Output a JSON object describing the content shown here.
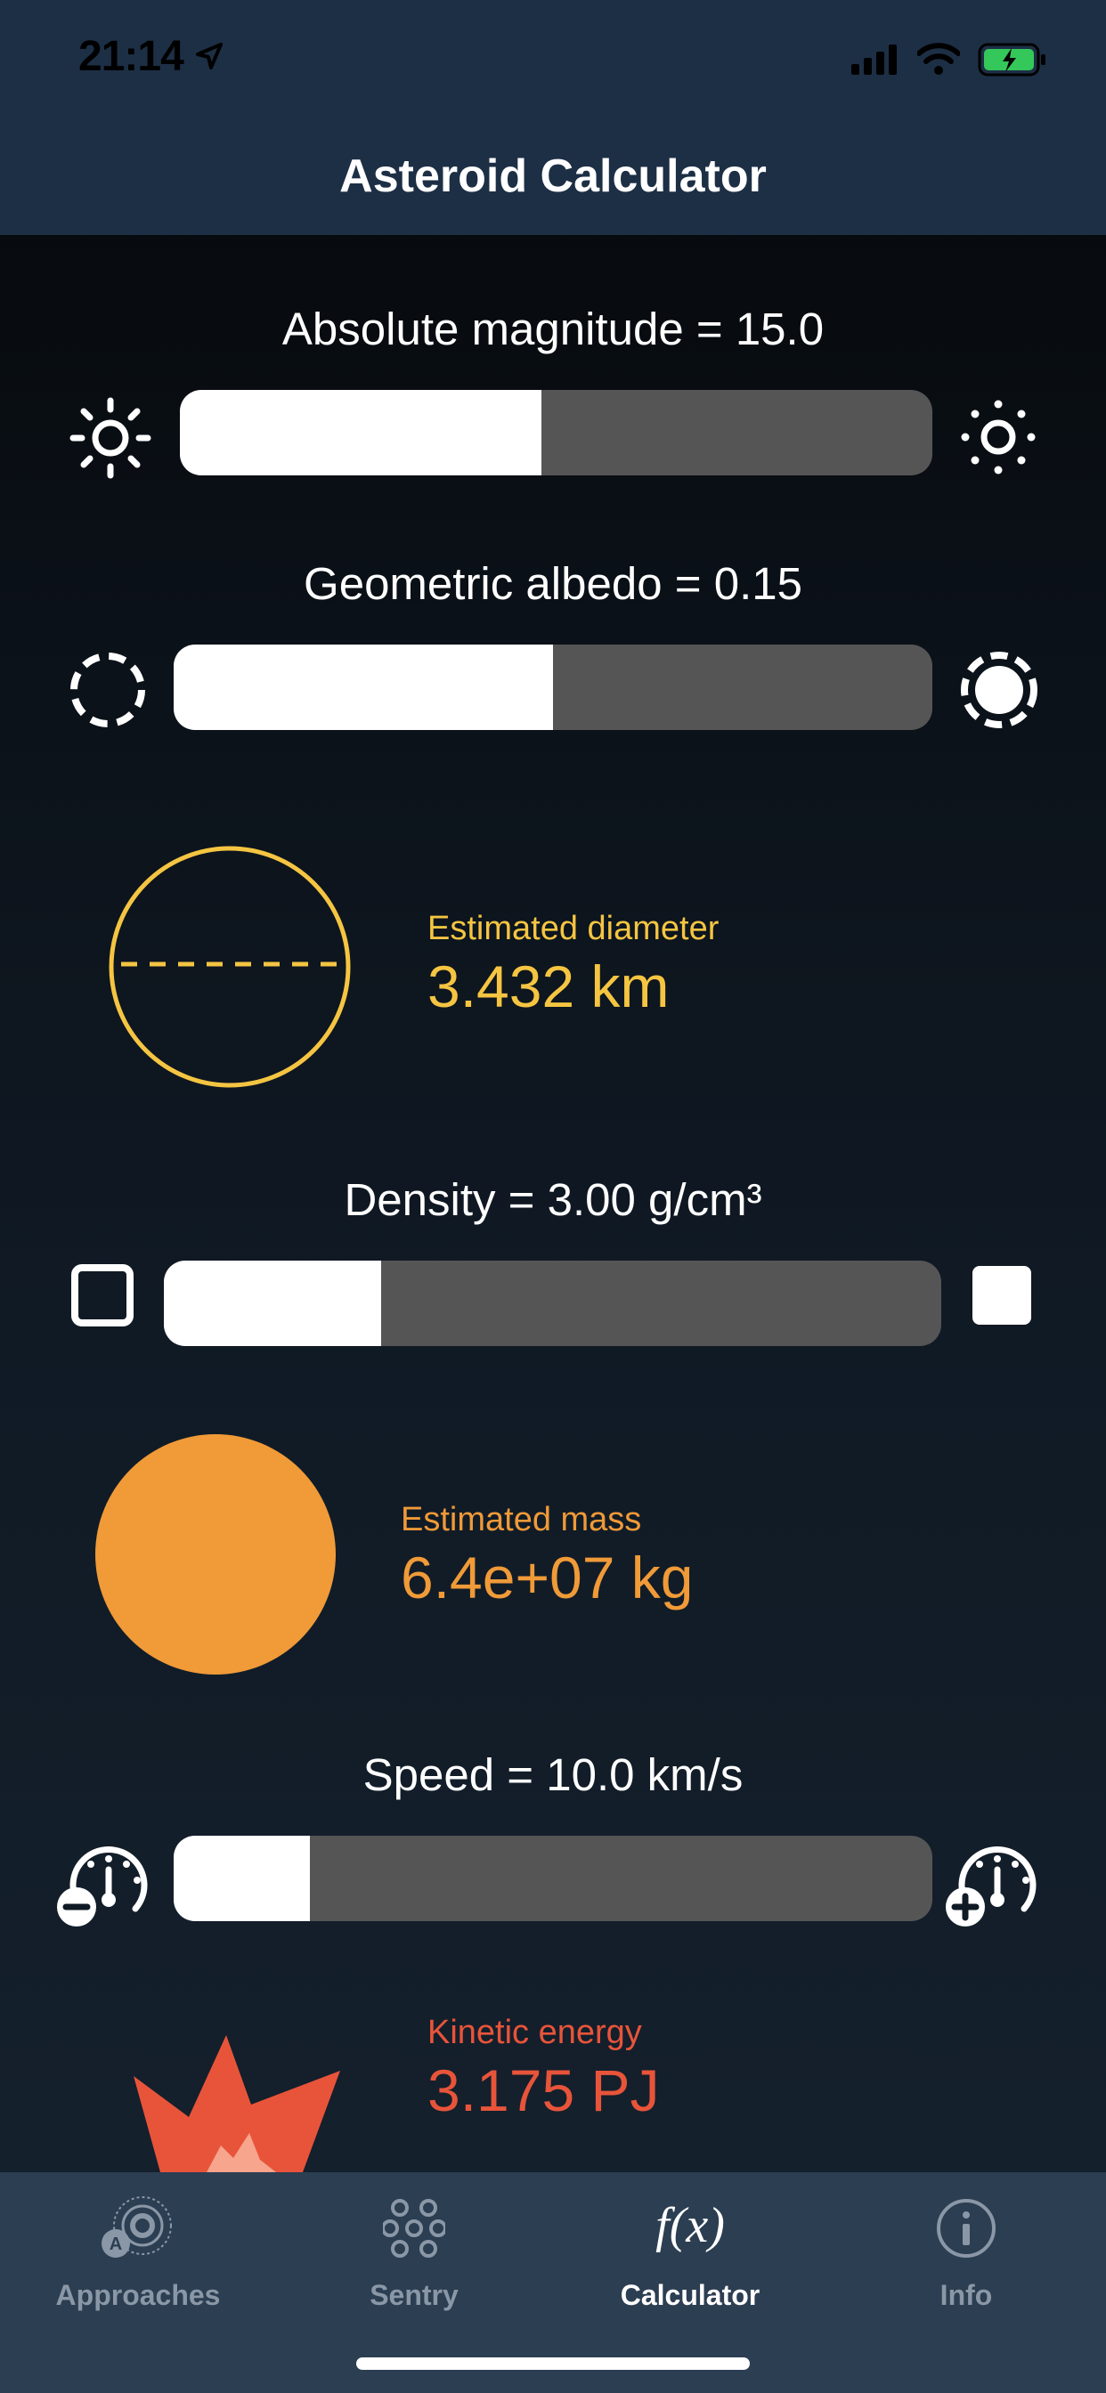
{
  "status": {
    "time": "21:14"
  },
  "nav": {
    "title": "Asteroid Calculator"
  },
  "magnitude": {
    "label": "Absolute magnitude =  15.0",
    "value": 0.48
  },
  "albedo": {
    "label": "Geometric albedo =  0.15",
    "value": 0.5
  },
  "diameter": {
    "caption": "Estimated diameter",
    "value": "3.432 km"
  },
  "density": {
    "label": "Density =  3.00 g/cm³",
    "value": 0.28
  },
  "mass": {
    "caption": "Estimated mass",
    "value": "6.4e+07 kg"
  },
  "speed": {
    "label": "Speed =  10.0 km/s",
    "value": 0.18
  },
  "energy": {
    "caption": "Kinetic energy",
    "value": "3.175 PJ"
  },
  "tabs": [
    {
      "label": "Approaches",
      "icon": "approaches-icon"
    },
    {
      "label": "Sentry",
      "icon": "sentry-icon"
    },
    {
      "label": "Calculator",
      "icon": "function-icon"
    },
    {
      "label": "Info",
      "icon": "info-icon"
    }
  ],
  "colors": {
    "diameter": "#f5c542",
    "mass": "#f09a38",
    "energy": "#e8543a",
    "accent_nav": "#1d2f45"
  }
}
